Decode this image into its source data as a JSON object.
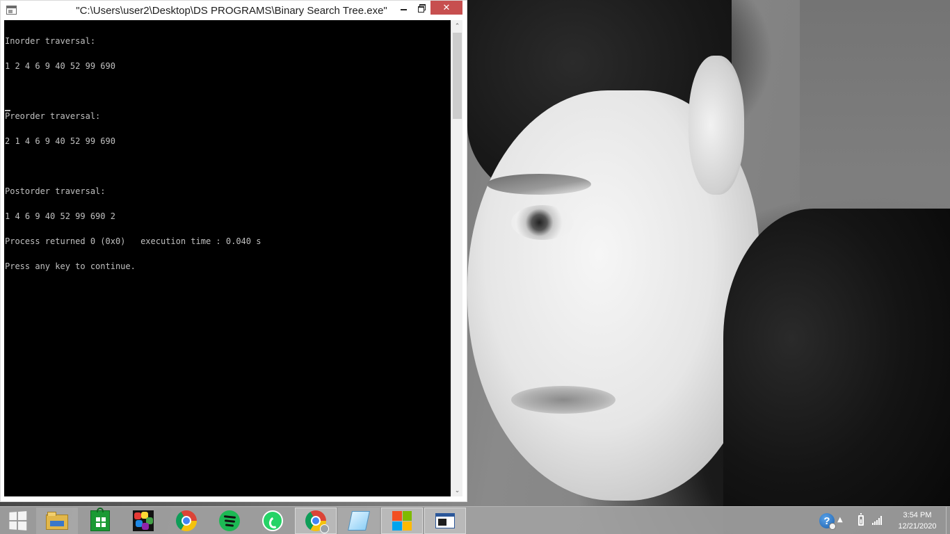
{
  "window": {
    "title": "\"C:\\Users\\user2\\Desktop\\DS PROGRAMS\\Binary Search Tree.exe\"",
    "minimize_icon": "minimize-icon",
    "restore_icon": "restore-icon",
    "close_icon": "close-icon",
    "close_glyph": "✕",
    "close_color": "#c74f4f"
  },
  "console": {
    "background": "#000000",
    "text_color": "#c0c0c0",
    "lines": [
      "Inorder traversal:",
      "1 2 4 6 9 40 52 99 690",
      "",
      "Preorder traversal:",
      "2 1 4 6 9 40 52 99 690",
      "",
      "Postorder traversal:",
      "1 4 6 9 40 52 99 690 2",
      "Process returned 0 (0x0)   execution time : 0.040 s",
      "Press any key to continue."
    ]
  },
  "scrollbar": {
    "up_glyph": "⌃",
    "down_glyph": "⌄"
  },
  "taskbar": {
    "items": [
      {
        "name": "file-explorer",
        "icon": "folder-icon"
      },
      {
        "name": "windows-store",
        "icon": "store-icon"
      },
      {
        "name": "games",
        "icon": "games-icon"
      },
      {
        "name": "google-chrome",
        "icon": "chrome-icon"
      },
      {
        "name": "spotify",
        "icon": "spotify-icon"
      },
      {
        "name": "whatsapp",
        "icon": "whatsapp-icon"
      },
      {
        "name": "chrome-user-profile",
        "icon": "chrome-profile-icon"
      },
      {
        "name": "notepad",
        "icon": "notepad-icon"
      },
      {
        "name": "microsoft-office",
        "icon": "office-icon"
      },
      {
        "name": "console-program",
        "icon": "console-icon"
      }
    ]
  },
  "tray": {
    "help_glyph": "?",
    "arrow_glyph": "▲",
    "time": "3:54 PM",
    "date": "12/21/2020"
  }
}
